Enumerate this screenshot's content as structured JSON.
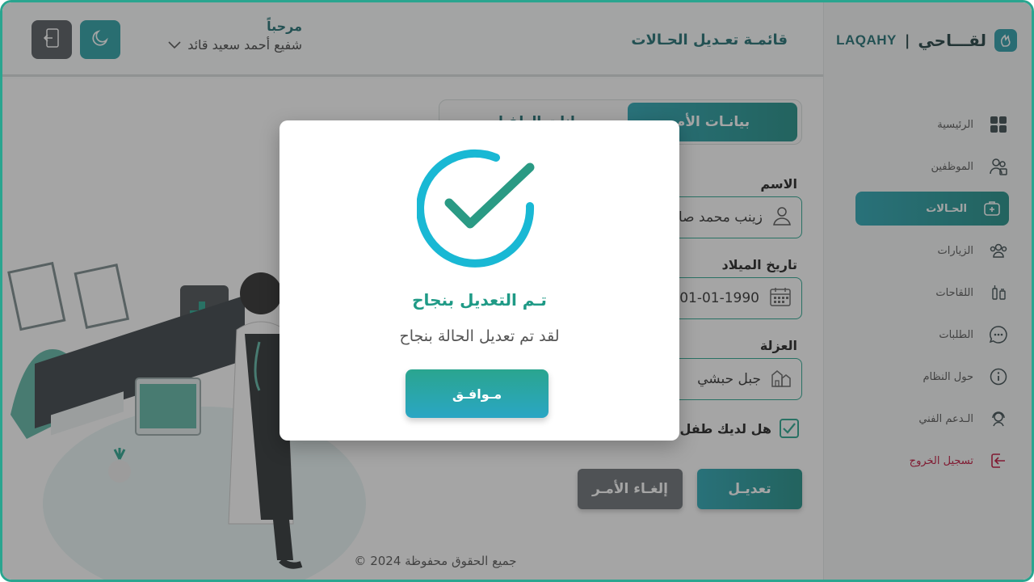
{
  "brand": {
    "latin": "LAQAHY",
    "separator": "|",
    "arabic": "لقـــاحي"
  },
  "colors": {
    "accent": "#2aa58f",
    "accent_blue": "#2aa6b4",
    "logout": "#c0123a",
    "dark_button": "#555b5f"
  },
  "sidebar": {
    "items": [
      {
        "label": "الرئيسية",
        "icon": "grid-icon"
      },
      {
        "label": "الموظفين",
        "icon": "staff-icon"
      },
      {
        "label": "الحـالات",
        "icon": "first-aid-icon",
        "active": true
      },
      {
        "label": "الزيارات",
        "icon": "users-icon"
      },
      {
        "label": "اللقاحات",
        "icon": "vaccine-icon"
      },
      {
        "label": "الطلبات",
        "icon": "chat-icon"
      },
      {
        "label": "حول النظام",
        "icon": "info-icon"
      },
      {
        "label": "الـدعم الفني",
        "icon": "support-icon"
      },
      {
        "label": "تسجيل الخروج",
        "icon": "logout-icon"
      }
    ]
  },
  "header": {
    "title": "قائمـة تعـديل الحـالات",
    "greeting": "مرحباً",
    "user_name": "شفيع أحمد سعيد قائد"
  },
  "tabs": {
    "parent": "بيانـات الأم",
    "child": "بيانات الطفـل"
  },
  "form": {
    "name_label": "الاسم",
    "name_value": "زينب محمد صالح",
    "birth_label": "تاريخ الميلاد",
    "birth_value": "01-01-1990",
    "district_label": "العزلة",
    "district_value": "جبل حبشي",
    "has_child_label": "هل لديك طفل؟",
    "has_child_checked": true,
    "edit_button": "تعديـل",
    "cancel_button": "إلغـاء الأمـر"
  },
  "footer": {
    "copyright": "جميع الحقوق محفوظة 2024 ©"
  },
  "modal": {
    "title": "تـم التعديل بنجاح",
    "message": "لقد تم تعديل الحالة بنجاح",
    "ok_button": "مـوافـق"
  }
}
